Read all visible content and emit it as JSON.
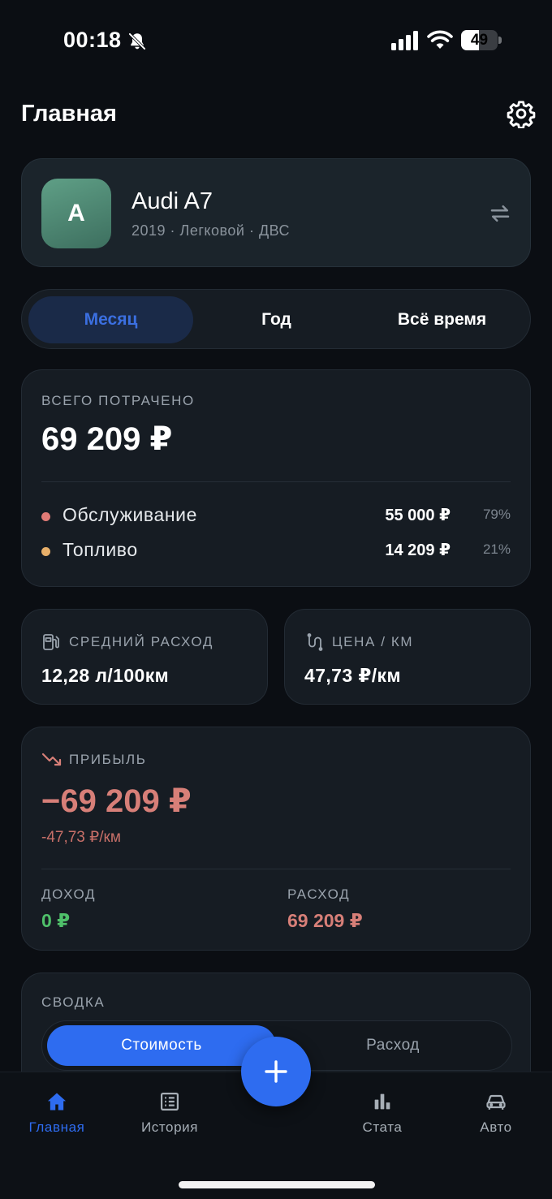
{
  "status_bar": {
    "time": "00:18",
    "battery": "49",
    "battery_level": 0.49,
    "icons": [
      "bell-off-icon",
      "signal-icon",
      "wifi-icon",
      "battery-icon"
    ]
  },
  "header": {
    "title": "Главная",
    "settings_icon": "gear-icon"
  },
  "vehicle": {
    "avatar_letter": "A",
    "name": "Audi A7",
    "meta": "2019 · Легковой · ДВС",
    "avatar_color": "#4f8a75",
    "switch_icon": "swap-arrows-icon"
  },
  "period_tabs": [
    {
      "label": "Месяц",
      "active": true
    },
    {
      "label": "Год",
      "active": false
    },
    {
      "label": "Всё время",
      "active": false
    }
  ],
  "spent": {
    "label": "ВСЕГО ПОТРАЧЕНО",
    "total": "69 209 ₽",
    "categories": [
      {
        "name": "Обслуживание",
        "amount": "55 000 ₽",
        "percent": "79%",
        "color": "#e07b76"
      },
      {
        "name": "Топливо",
        "amount": "14 209 ₽",
        "percent": "21%",
        "color": "#e8b06a"
      }
    ]
  },
  "metrics": {
    "avg_consumption": {
      "label": "СРЕДНИЙ РАСХОД",
      "value": "12,28 л/100км",
      "icon": "fuel-pump-icon"
    },
    "price_per_km": {
      "label": "ЦЕНА / КМ",
      "value": "47,73 ₽/км",
      "icon": "route-icon"
    }
  },
  "profit": {
    "label": "ПРИБЫЛЬ",
    "value": "−69 209 ₽",
    "per_km": "-47,73 ₽/км",
    "income_label": "ДОХОД",
    "income_value": "0 ₽",
    "expense_label": "РАСХОД",
    "expense_value": "69 209 ₽",
    "icon": "trend-down-icon",
    "negative_color": "#d77f78",
    "positive_color": "#4fc06a"
  },
  "summary": {
    "label": "СВОДКА",
    "toggle": [
      {
        "label": "Стоимость",
        "active": true
      },
      {
        "label": "Расход",
        "active": false
      }
    ]
  },
  "bottom_nav": [
    {
      "label": "Главная",
      "icon": "home-icon",
      "active": true
    },
    {
      "label": "История",
      "icon": "list-icon",
      "active": false
    },
    {
      "label": "Стата",
      "icon": "bar-chart-icon",
      "active": false
    },
    {
      "label": "Авто",
      "icon": "car-icon",
      "active": false
    }
  ],
  "fab_icon": "plus-icon",
  "colors": {
    "background": "#0b0e13",
    "card": "#161c23",
    "accent": "#2e6cf0",
    "active_tab_bg": "#1a2a48"
  }
}
